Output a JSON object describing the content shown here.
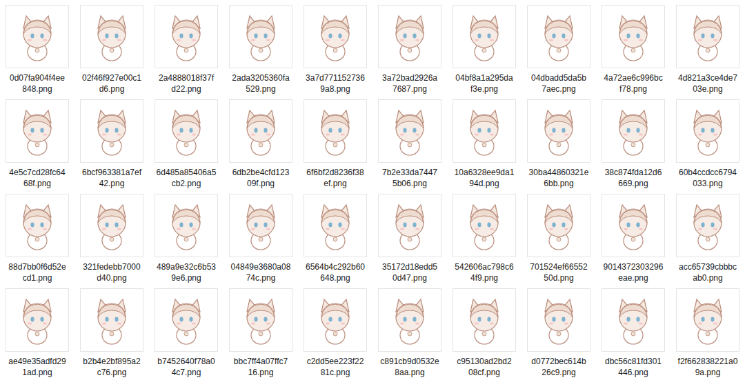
{
  "files": [
    {
      "lines": [
        "0d07fa904f4ee",
        "848.png"
      ]
    },
    {
      "lines": [
        "02f46f927e00c1",
        "d6.png"
      ]
    },
    {
      "lines": [
        "2a4888018f37f",
        "d22.png"
      ]
    },
    {
      "lines": [
        "2ada3205360fa",
        "529.png"
      ]
    },
    {
      "lines": [
        "3a7d771152736",
        "9a8.png"
      ]
    },
    {
      "lines": [
        "3a72bad2926a",
        "7687.png"
      ]
    },
    {
      "lines": [
        "04bf8a1a295da",
        "f3e.png"
      ]
    },
    {
      "lines": [
        "04dbadd5da5b",
        "7aec.png"
      ]
    },
    {
      "lines": [
        "4a72ae6c996bc",
        "f78.png"
      ]
    },
    {
      "lines": [
        "4d821a3ce4de7",
        "03e.png"
      ]
    },
    {
      "lines": [
        "4e5c7cd28fc64",
        "68f.png"
      ]
    },
    {
      "lines": [
        "6bcf963381a7ef",
        "42.png"
      ]
    },
    {
      "lines": [
        "6d485a85406a5",
        "cb2.png"
      ]
    },
    {
      "lines": [
        "6db2be4cfd123",
        "09f.png"
      ]
    },
    {
      "lines": [
        "6f6bf2d8236f38",
        "ef.png"
      ]
    },
    {
      "lines": [
        "7b2e33da7447",
        "5b06.png"
      ]
    },
    {
      "lines": [
        "10a6328ee9da1",
        "94d.png"
      ]
    },
    {
      "lines": [
        "30ba44860321e",
        "6bb.png"
      ]
    },
    {
      "lines": [
        "38c874fda12d6",
        "669.png"
      ]
    },
    {
      "lines": [
        "60b4ccdcc6794",
        "033.png"
      ]
    },
    {
      "lines": [
        "88d7bb0f6d52e",
        "cd1.png"
      ]
    },
    {
      "lines": [
        "321fedebb7000",
        "d40.png"
      ]
    },
    {
      "lines": [
        "489a9e32c6b53",
        "9e6.png"
      ]
    },
    {
      "lines": [
        "04849e3680a08",
        "74c.png"
      ]
    },
    {
      "lines": [
        "6564b4c292b60",
        "648.png"
      ]
    },
    {
      "lines": [
        "35172d18edd5",
        "0d47.png"
      ]
    },
    {
      "lines": [
        "542606ac798c6",
        "4f9.png"
      ]
    },
    {
      "lines": [
        "701524ef66552",
        "50d.png"
      ]
    },
    {
      "lines": [
        "9014372303296",
        "eae.png"
      ]
    },
    {
      "lines": [
        "acc65739cbbbc",
        "ab0.png"
      ]
    },
    {
      "lines": [
        "ae49e35adfd29",
        "1ad.png"
      ]
    },
    {
      "lines": [
        "b2b4e2bf895a2",
        "c76.png"
      ]
    },
    {
      "lines": [
        "b7452640f78a0",
        "4c7.png"
      ]
    },
    {
      "lines": [
        "bbc7ff4a07ffc7",
        "16.png"
      ]
    },
    {
      "lines": [
        "c2dd5ee223f22",
        "81c.png"
      ]
    },
    {
      "lines": [
        "c891cb9d0532e",
        "8aa.png"
      ]
    },
    {
      "lines": [
        "c95130ad2bd2",
        "08cf.png"
      ]
    },
    {
      "lines": [
        "d0772bec614b",
        "26c9.png"
      ]
    },
    {
      "lines": [
        "dbc56c81fd301",
        "446.png"
      ]
    },
    {
      "lines": [
        "f2f662838221a0",
        "9a.png"
      ]
    }
  ]
}
